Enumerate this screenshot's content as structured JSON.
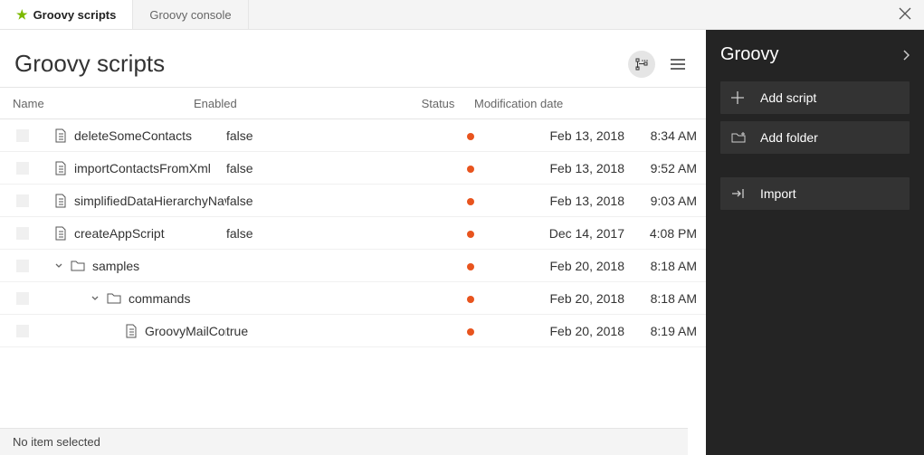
{
  "tabs": [
    {
      "label": "Groovy scripts",
      "active": true
    },
    {
      "label": "Groovy console",
      "active": false
    }
  ],
  "page_title": "Groovy scripts",
  "columns": {
    "name": "Name",
    "enabled": "Enabled",
    "status": "Status",
    "date": "Modification date"
  },
  "rows": [
    {
      "type": "file",
      "indent": 1,
      "name": "deleteSomeContacts",
      "enabled": "false",
      "date": "Feb 13, 2018",
      "time": "8:34 AM"
    },
    {
      "type": "file",
      "indent": 1,
      "name": "importContactsFromXml",
      "enabled": "false",
      "date": "Feb 13, 2018",
      "time": "9:52 AM"
    },
    {
      "type": "file",
      "indent": 1,
      "name": "simplifiedDataHierarchyNav",
      "enabled": "false",
      "date": "Feb 13, 2018",
      "time": "9:03 AM"
    },
    {
      "type": "file",
      "indent": 1,
      "name": "createAppScript",
      "enabled": "false",
      "date": "Dec 14, 2017",
      "time": "4:08 PM"
    },
    {
      "type": "folder",
      "indent": 1,
      "expanded": true,
      "name": "samples",
      "enabled": "",
      "date": "Feb 20, 2018",
      "time": "8:18 AM"
    },
    {
      "type": "folder",
      "indent": 2,
      "expanded": true,
      "name": "commands",
      "enabled": "",
      "date": "Feb 20, 2018",
      "time": "8:18 AM"
    },
    {
      "type": "file",
      "indent": 3,
      "name": "GroovyMailCommand",
      "enabled": "true",
      "date": "Feb 20, 2018",
      "time": "8:19 AM"
    }
  ],
  "sidebar": {
    "title": "Groovy",
    "actions": [
      {
        "icon": "plus",
        "label": "Add script"
      },
      {
        "icon": "folder-plus",
        "label": "Add folder"
      }
    ],
    "import_label": "Import"
  },
  "statusbar": "No item selected",
  "status_color": "#e8541e"
}
